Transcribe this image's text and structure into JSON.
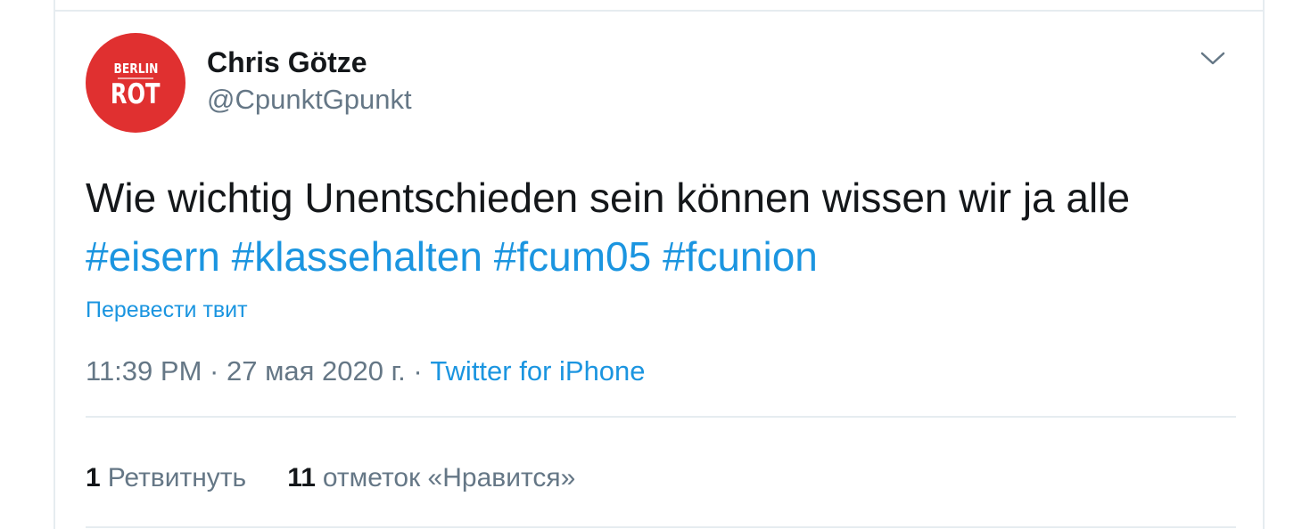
{
  "tweet": {
    "avatar": {
      "logo_top": "BERLIN",
      "logo_bottom": "ROT",
      "color": "#e03030"
    },
    "author": {
      "name": "Chris Götze",
      "handle": "@CpunktGpunkt"
    },
    "menu_icon": "chevron-down-icon",
    "text_plain": "Wie wichtig Unentschieden sein können wissen wir ja alle",
    "hashtags": [
      "#eisern",
      "#klassehalten",
      "#fcum05",
      "#fcunion"
    ],
    "translate_label": "Перевести твит",
    "time": "11:39 PM",
    "date": "27 мая 2020 г.",
    "source": "Twitter for iPhone",
    "separator": "·",
    "stats": {
      "retweets_count": "1",
      "retweets_label": "Ретвитнуть",
      "likes_count": "11",
      "likes_label": "отметок «Нравится»"
    }
  },
  "colors": {
    "link": "#1b95e0",
    "text_primary": "#14171a",
    "text_secondary": "#657786",
    "divider": "#e6ecf0"
  }
}
